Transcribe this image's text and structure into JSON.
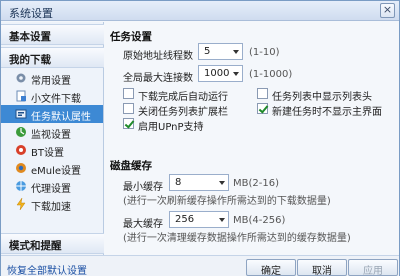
{
  "window": {
    "title": "系统设置",
    "close_label": "×"
  },
  "sidebar": {
    "header_basic": "基本设置",
    "header_downloads": "我的下载",
    "items": [
      {
        "label": "常用设置",
        "icon": "gear-icon"
      },
      {
        "label": "小文件下载",
        "icon": "small-file-icon"
      },
      {
        "label": "任务默认属性",
        "icon": "task-properties-icon"
      },
      {
        "label": "监视设置",
        "icon": "monitor-icon"
      },
      {
        "label": "BT设置",
        "icon": "bt-icon"
      },
      {
        "label": "eMule设置",
        "icon": "emule-icon"
      },
      {
        "label": "代理设置",
        "icon": "proxy-icon"
      },
      {
        "label": "下载加速",
        "icon": "accelerate-icon"
      }
    ],
    "header_mode": "模式和提醒",
    "restore_link": "恢复全部默认设置"
  },
  "task": {
    "section_title": "任务设置",
    "orig_threads_label": "原始地址线程数",
    "orig_threads_value": "5",
    "orig_threads_range": "(1-10)",
    "max_conn_label": "全局最大连接数",
    "max_conn_value": "1000",
    "max_conn_range": "(1-1000)",
    "checkboxes": [
      {
        "label": "下载完成后自动运行",
        "checked": false
      },
      {
        "label": "任务列表中显示列表头",
        "checked": false
      },
      {
        "label": "关闭任务列表扩展栏",
        "checked": false
      },
      {
        "label": "新建任务时不显示主界面",
        "checked": true
      },
      {
        "label": "启用UPnP支持",
        "checked": true
      }
    ]
  },
  "cache": {
    "section_title": "磁盘缓存",
    "min_label": "最小缓存",
    "min_value": "8",
    "min_unit": "MB(2-16)",
    "min_hint": "(进行一次刷新缓存操作所需达到的下载数据量)",
    "max_label": "最大缓存",
    "max_value": "256",
    "max_unit": "MB(4-256)",
    "max_hint": "(进行一次清理缓存数据操作所需达到的缓存数据量)"
  },
  "buttons": {
    "ok": "确定",
    "cancel": "取消",
    "apply": "应用"
  },
  "colors": {
    "selected": "#3d89d4",
    "link": "#1a4fa3"
  }
}
